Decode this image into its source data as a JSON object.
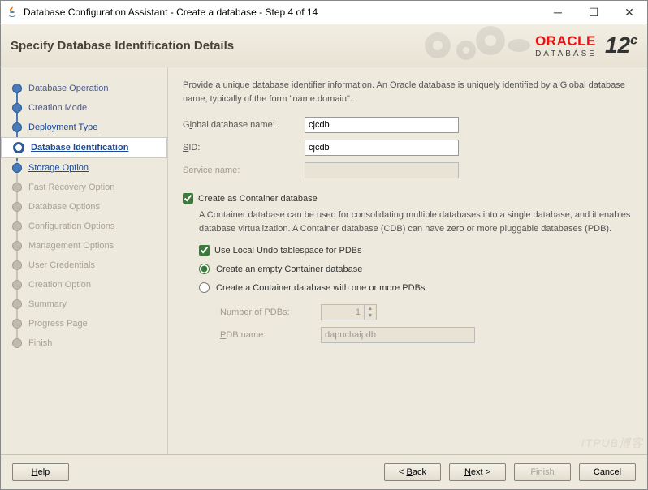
{
  "window": {
    "title": "Database Configuration Assistant - Create a database - Step 4 of 14"
  },
  "header": {
    "title": "Specify Database Identification Details",
    "brand_word": "ORACLE",
    "brand_sub": "DATABASE",
    "version": "12",
    "version_sup": "c"
  },
  "steps": [
    {
      "label": "Database Operation"
    },
    {
      "label": "Creation Mode"
    },
    {
      "label": "Deployment Type"
    },
    {
      "label": "Database Identification"
    },
    {
      "label": "Storage Option"
    },
    {
      "label": "Fast Recovery Option"
    },
    {
      "label": "Database Options"
    },
    {
      "label": "Configuration Options"
    },
    {
      "label": "Management Options"
    },
    {
      "label": "User Credentials"
    },
    {
      "label": "Creation Option"
    },
    {
      "label": "Summary"
    },
    {
      "label": "Progress Page"
    },
    {
      "label": "Finish"
    }
  ],
  "intro": "Provide a unique database identifier information. An Oracle database is uniquely identified by a Global database name, typically of the form \"name.domain\".",
  "form": {
    "global_label_pre": "G",
    "global_label_u": "l",
    "global_label_post": "obal database name:",
    "global_value": "cjcdb",
    "sid_label_u": "S",
    "sid_label_post": "ID:",
    "sid_value": "cjcdb",
    "service_label": "Service name:",
    "service_value": ""
  },
  "container": {
    "create_label_u": "C",
    "create_label_post": "reate as Container database",
    "desc": "A Container database can be used for consolidating multiple databases into a single database, and it enables database virtualization. A Container database (CDB) can have zero or more pluggable databases (PDB).",
    "undo_label_u": "U",
    "undo_label_post": "se Local Undo tablespace for PDBs",
    "radio_empty": "Create an empty Container database",
    "radio_pdbs": "Create a Container database with one or more PDBs",
    "num_pdbs_label_pre": "N",
    "num_pdbs_label_u": "u",
    "num_pdbs_label_post": "mber of PDBs:",
    "num_pdbs_value": "1",
    "pdb_name_label_u": "P",
    "pdb_name_label_post": "DB name:",
    "pdb_name_value": "dapuchaipdb"
  },
  "buttons": {
    "help": "Help",
    "back": "< Back",
    "next": "Next >",
    "finish": "Finish",
    "cancel": "Cancel"
  },
  "watermark": "ITPUB博客"
}
